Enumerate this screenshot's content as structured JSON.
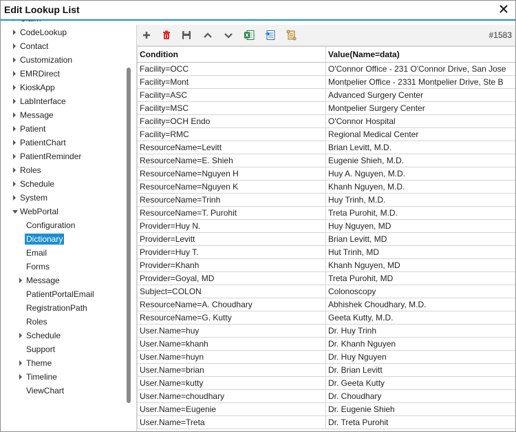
{
  "window": {
    "title": "Edit Lookup List"
  },
  "tree": {
    "items": [
      {
        "label": "Claim",
        "level": 0,
        "expander": "right"
      },
      {
        "label": "CodeLookup",
        "level": 0,
        "expander": "right"
      },
      {
        "label": "Contact",
        "level": 0,
        "expander": "right"
      },
      {
        "label": "Customization",
        "level": 0,
        "expander": "right"
      },
      {
        "label": "EMRDirect",
        "level": 0,
        "expander": "right"
      },
      {
        "label": "KioskApp",
        "level": 0,
        "expander": "right"
      },
      {
        "label": "LabInterface",
        "level": 0,
        "expander": "right"
      },
      {
        "label": "Message",
        "level": 0,
        "expander": "right"
      },
      {
        "label": "Patient",
        "level": 0,
        "expander": "right"
      },
      {
        "label": "PatientChart",
        "level": 0,
        "expander": "right"
      },
      {
        "label": "PatientReminder",
        "level": 0,
        "expander": "right"
      },
      {
        "label": "Roles",
        "level": 0,
        "expander": "right"
      },
      {
        "label": "Schedule",
        "level": 0,
        "expander": "right"
      },
      {
        "label": "System",
        "level": 0,
        "expander": "right"
      },
      {
        "label": "WebPortal",
        "level": 0,
        "expander": "down"
      },
      {
        "label": "Configuration",
        "level": 1,
        "expander": "none"
      },
      {
        "label": "Dictionary",
        "level": 1,
        "expander": "none",
        "selected": true
      },
      {
        "label": "Email",
        "level": 1,
        "expander": "none"
      },
      {
        "label": "Forms",
        "level": 1,
        "expander": "none"
      },
      {
        "label": "Message",
        "level": 1,
        "expander": "right"
      },
      {
        "label": "PatientPortalEmail",
        "level": 1,
        "expander": "none"
      },
      {
        "label": "RegistrationPath",
        "level": 1,
        "expander": "none"
      },
      {
        "label": "Roles",
        "level": 1,
        "expander": "none"
      },
      {
        "label": "Schedule",
        "level": 1,
        "expander": "right"
      },
      {
        "label": "Support",
        "level": 1,
        "expander": "none"
      },
      {
        "label": "Theme",
        "level": 1,
        "expander": "right"
      },
      {
        "label": "Timeline",
        "level": 1,
        "expander": "right"
      },
      {
        "label": "ViewChart",
        "level": 1,
        "expander": "none"
      }
    ]
  },
  "toolbar": {
    "icons": [
      "add-icon",
      "delete-icon",
      "save-icon",
      "move-up-icon",
      "move-down-icon",
      "excel-export-icon",
      "import-icon",
      "scroll-icon"
    ],
    "record_id": "#1583"
  },
  "grid": {
    "columns": [
      "Condition",
      "Value(Name=data)"
    ],
    "rows": [
      [
        "Facility=OCC",
        "O'Connor Office - 231 O'Connor Drive, San Jose"
      ],
      [
        "Facility=Mont",
        "Montpelier Office - 2331 Montpelier Drive, Ste B"
      ],
      [
        "Facility=ASC",
        "Advanced Surgery Center"
      ],
      [
        "Facility=MSC",
        "Montpelier Surgery Center"
      ],
      [
        "Facility=OCH Endo",
        "O'Connor Hospital"
      ],
      [
        "Facility=RMC",
        "Regional Medical Center"
      ],
      [
        "ResourceName=Levitt",
        "Brian Levitt, M.D."
      ],
      [
        "ResourceName=E. Shieh",
        "Eugenie Shieh, M.D."
      ],
      [
        "ResourceName=Nguyen H",
        "Huy A. Nguyen, M.D."
      ],
      [
        "ResourceName=Nguyen K",
        "Khanh Nguyen, M.D."
      ],
      [
        "ResourceName=Trinh",
        "Huy Trinh, M.D."
      ],
      [
        "ResourceName=T. Purohit",
        "Treta Purohit, M.D."
      ],
      [
        "Provider=Huy N.",
        "Huy Nguyen, MD"
      ],
      [
        "Provider=Levitt",
        "Brian Levitt, MD"
      ],
      [
        "Provider=Huy T.",
        "Hut Trinh, MD"
      ],
      [
        "Provider=Khanh",
        "Khanh Nguyen, MD"
      ],
      [
        "Provider=Goyal, MD",
        "Treta Purohit, MD"
      ],
      [
        "Subject=COLON",
        "Colonoscopy"
      ],
      [
        "ResourceName=A. Choudhary",
        "Abhishek Choudhary, M.D."
      ],
      [
        "ResourceName=G. Kutty",
        "Geeta Kutty, M.D."
      ],
      [
        "User.Name=huy",
        "Dr. Huy Trinh"
      ],
      [
        "User.Name=khanh",
        "Dr. Khanh Nguyen"
      ],
      [
        "User.Name=huyn",
        "Dr. Huy Nguyen"
      ],
      [
        "User.Name=brian",
        "Dr. Brian Levitt"
      ],
      [
        "User.Name=kutty",
        "Dr. Geeta Kutty"
      ],
      [
        "User.Name=choudhary",
        "Dr. Choudhary"
      ],
      [
        "User.Name=Eugenie",
        "Dr. Eugenie Shieh"
      ],
      [
        "User.Name=Treta",
        "Dr. Treta Purohit"
      ]
    ]
  }
}
